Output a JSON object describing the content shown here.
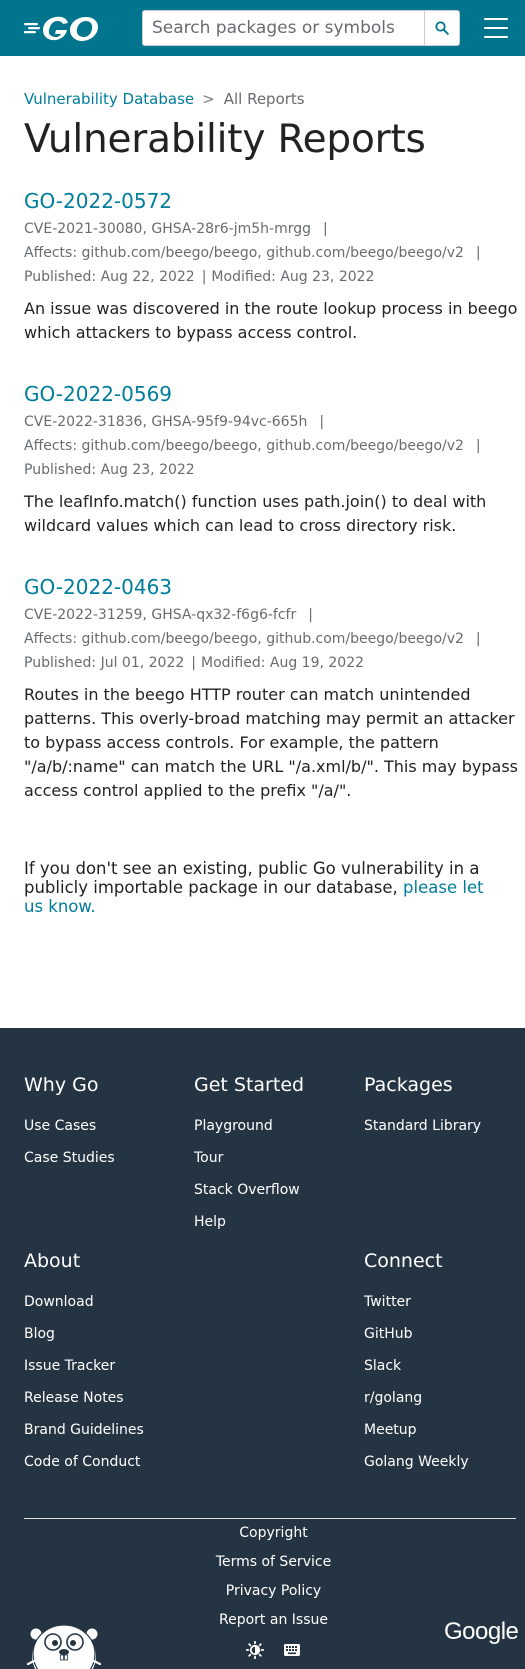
{
  "header": {
    "logo_alt": "Go",
    "search_placeholder": "Search packages or symbols"
  },
  "breadcrumb": {
    "root": "Vulnerability Database",
    "separator": ">",
    "current": "All Reports"
  },
  "page_title": "Vulnerability Reports",
  "reports": [
    {
      "id": "GO-2022-0572",
      "aliases": "CVE-2021-30080, GHSA-28r6-jm5h-mrgg",
      "affects": "Affects: github.com/beego/beego, github.com/beego/beego/v2",
      "published": "Published: Aug 22, 2022",
      "modified": "Modified: Aug 23, 2022",
      "description": "An issue was discovered in the route lookup process in beego which attackers to bypass access control."
    },
    {
      "id": "GO-2022-0569",
      "aliases": "CVE-2022-31836, GHSA-95f9-94vc-665h",
      "affects": "Affects: github.com/beego/beego, github.com/beego/beego/v2",
      "published": "Published: Aug 23, 2022",
      "modified": "",
      "description": "The leafInfo.match() function uses path.join() to deal with wildcard values which can lead to cross directory risk."
    },
    {
      "id": "GO-2022-0463",
      "aliases": "CVE-2022-31259, GHSA-qx32-f6g6-fcfr",
      "affects": "Affects: github.com/beego/beego, github.com/beego/beego/v2",
      "published": "Published: Jul 01, 2022",
      "modified": "Modified: Aug 19, 2022",
      "description": "Routes in the beego HTTP router can match unintended patterns. This overly-broad matching may permit an attacker to bypass access controls. For example, the pattern \"/a/b/:name\" can match the URL \"/a.xml/b/\". This may bypass access control applied to the prefix \"/a/\"."
    }
  ],
  "not_found": {
    "text": "If you don't see an existing, public Go vulnerability in a publicly importable package in our database,",
    "link": "please let us know."
  },
  "footer": {
    "columns": [
      {
        "heading": "Why Go",
        "items": [
          "Use Cases",
          "Case Studies"
        ]
      },
      {
        "heading": "Get Started",
        "items": [
          "Playground",
          "Tour",
          "Stack Overflow",
          "Help"
        ]
      },
      {
        "heading": "Packages",
        "items": [
          "Standard Library"
        ]
      },
      {
        "heading": "About",
        "items": [
          "Download",
          "Blog",
          "Issue Tracker",
          "Release Notes",
          "Brand Guidelines",
          "Code of Conduct"
        ]
      },
      {
        "heading": "Connect",
        "items": [
          "Twitter",
          "GitHub",
          "Slack",
          "r/golang",
          "Meetup",
          "Golang Weekly"
        ]
      }
    ],
    "bottom_links": [
      "Copyright",
      "Terms of Service",
      "Privacy Policy",
      "Report an Issue"
    ],
    "google_logo": "Google",
    "icons": {
      "gopher": "gopher-mascot-icon",
      "theme": "theme-toggle-icon",
      "keyboard": "keyboard-icon"
    }
  },
  "colors": {
    "header_bg": "#00758d",
    "link": "#007d9c",
    "footer_bg": "#253443",
    "text": "#202224",
    "muted": "#686c70"
  }
}
